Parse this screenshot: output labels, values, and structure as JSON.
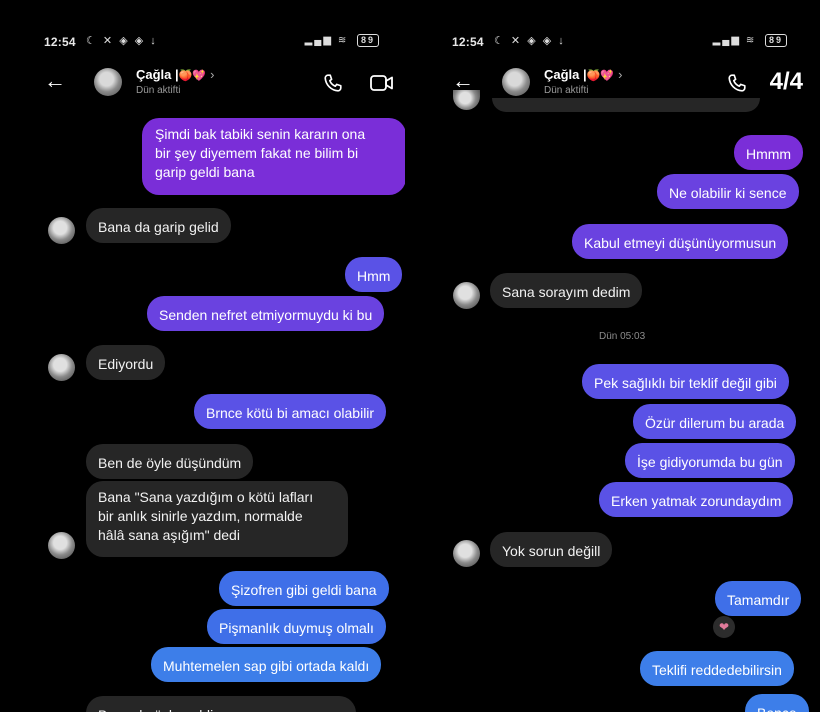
{
  "left": {
    "status": {
      "time": "12:54",
      "battery": "89"
    },
    "header": {
      "name": "Çağla |",
      "emoji": "🍑💖",
      "chevron": "›",
      "status": "Dün aktifti"
    },
    "messages": [
      {
        "dir": "out",
        "text": "Şimdi bak tabiki senin kararın ona\nbir şey diyemem fakat ne bilim bi\ngarip geldi bana"
      },
      {
        "dir": "in",
        "text": "Bana da garip gelid"
      },
      {
        "dir": "out",
        "text": "Hmm"
      },
      {
        "dir": "out",
        "text": "Senden nefret etmiyormuydu ki bu"
      },
      {
        "dir": "in",
        "text": "Ediyordu"
      },
      {
        "dir": "out",
        "text": "Brnce kötü bi amacı olabilir"
      },
      {
        "dir": "in",
        "text": "Ben de öyle düşündüm"
      },
      {
        "dir": "in",
        "text": "Bana \"Sana yazdığım o kötü lafları\nbir anlık sinirle yazdım, normalde\nhâlâ sana aşığım\" dedi"
      },
      {
        "dir": "out",
        "text": "Şizofren gibi geldi bana"
      },
      {
        "dir": "out",
        "text": "Pişmanlık duymuş olmalı"
      },
      {
        "dir": "out",
        "text": "Muhtemelen sap gibi ortada kaldı"
      },
      {
        "dir": "in",
        "text": "Bana da öyle geldi"
      }
    ]
  },
  "right": {
    "status": {
      "time": "12:54",
      "battery": "89"
    },
    "header": {
      "name": "Çağla |",
      "emoji": "🍑💖",
      "chevron": "›",
      "status": "Dün aktifti",
      "page_count": "4/4"
    },
    "timestamp": "Dün 05:03",
    "messages": [
      {
        "dir": "out",
        "text": "Hmmm"
      },
      {
        "dir": "out",
        "text": "Ne olabilir ki sence"
      },
      {
        "dir": "out",
        "text": "Kabul etmeyi düşünüyormusun"
      },
      {
        "dir": "in",
        "text": "Sana sorayım dedim"
      },
      {
        "dir": "out",
        "text": "Pek sağlıklı bir teklif değil gibi"
      },
      {
        "dir": "out",
        "text": "Özür dilerum bu arada"
      },
      {
        "dir": "out",
        "text": "İşe gidiyorumda bu gün"
      },
      {
        "dir": "out",
        "text": "Erken yatmak zorundaydım"
      },
      {
        "dir": "in",
        "text": "Yok sorun değill"
      },
      {
        "dir": "out",
        "text": "Tamamdır"
      },
      {
        "dir": "out",
        "text": "Teklifi reddedebilirsin"
      },
      {
        "dir": "out",
        "text": "Bence"
      }
    ],
    "reaction": "❤"
  },
  "colors": {
    "incoming": "#262626",
    "outgoing_purple": "#7a2ed8",
    "outgoing_blue": "#3f6fe8",
    "background": "#000000"
  },
  "icons": {
    "back": "back-arrow-icon",
    "call": "phone-icon",
    "video": "video-camera-icon"
  }
}
